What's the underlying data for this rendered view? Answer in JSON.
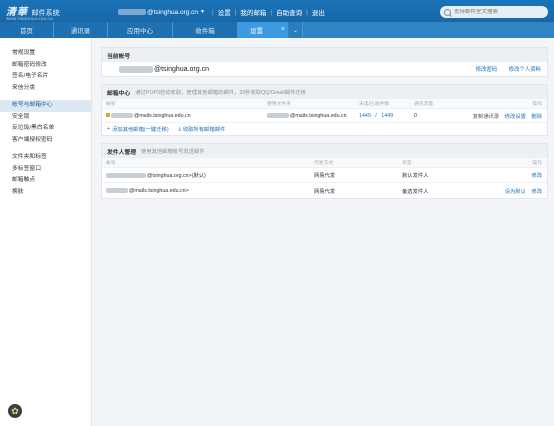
{
  "header": {
    "logo_mark": "清華",
    "logo_text": "邮件系统",
    "logo_sub": "WWW.TSINGHUA.EDU.CN",
    "user_domain": "@tsinghua.org.cn",
    "links": [
      "设置",
      "我的邮箱",
      "自助查询",
      "退出"
    ],
    "search_placeholder": "支持邮件全文搜索"
  },
  "tabs": [
    {
      "label": "首页"
    },
    {
      "label": "通讯录"
    },
    {
      "label": "应用中心"
    },
    {
      "label": "收件箱"
    },
    {
      "label": "设置"
    }
  ],
  "sidebar": {
    "group1": [
      "常规设置",
      "邮箱密码修改",
      "签名/电子名片",
      "来信分类"
    ],
    "group2": [
      "帐号与邮箱中心",
      "安全锁",
      "反垃圾/黑白名单",
      "客户端授权密码"
    ],
    "group3": [
      "文件夹和标签",
      "多标签窗口",
      "邮箱触点",
      "换肤"
    ]
  },
  "current_account": {
    "title": "当前帐号",
    "domain": "@tsinghua.org.cn",
    "links": [
      "修改密码",
      "修改个人资料"
    ]
  },
  "mail_center": {
    "title": "邮箱中心",
    "desc": "通过POP3自动收取，管理其他邮箱的邮件，20秒收取QQ/Gmail邮件迁移",
    "columns": [
      "帐号",
      "使用文件夹",
      "未读/已收件数",
      "通讯流量",
      "操作"
    ],
    "row": {
      "account_domain": "@mails.tsinghua.edu.cn",
      "folder_domain": "@mails.tsinghua.edu.cn",
      "unread": "1449",
      "slash": "/",
      "total": "1449",
      "traffic": "0",
      "action_muted": "复制通讯录",
      "action1": "修改设置",
      "action2": "删除"
    },
    "add_link": "添加其他邮箱(一键迁移)",
    "receive_link": "收取所有邮箱邮件"
  },
  "sender": {
    "title": "发件人管理",
    "desc": "使用其他邮箱帐号发送邮件",
    "columns": [
      "帐号",
      "代发方式",
      "状态",
      "操作"
    ],
    "rows": [
      {
        "account": "@tsinghua.org.cn>(默认)",
        "method": "网易代发",
        "status": "默认发件人",
        "actions": [
          "修改"
        ]
      },
      {
        "account": "@mails.tsinghua.edu.cn>",
        "method": "网易代发",
        "status": "备选发件人",
        "actions": [
          "设为默认",
          "修改"
        ]
      }
    ]
  }
}
